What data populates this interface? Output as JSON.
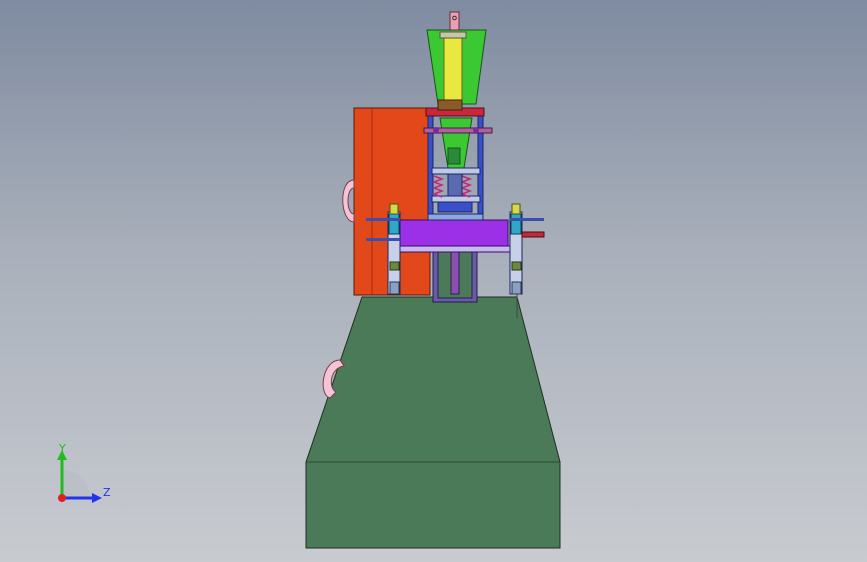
{
  "triad": {
    "y_label": "Y",
    "z_label": "Z",
    "y_color": "#22bb22",
    "z_color": "#2233ee",
    "x_color": "#dd2222"
  },
  "colors": {
    "base": "#4a7a58",
    "cabinet": "#e2481a",
    "hopper": "#3cc832",
    "cylinder": "#e8e840",
    "table": "#9b30e6",
    "frame": "#3a50c8",
    "handle": "#f2c4d4",
    "background_top": "#7f8ba0",
    "background_bottom": "#c8cbd0"
  }
}
